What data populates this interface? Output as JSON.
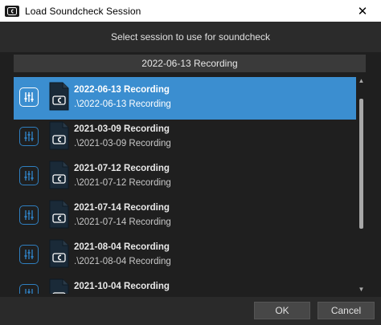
{
  "window": {
    "title": "Load Soundcheck Session",
    "close_glyph": "✕"
  },
  "header": {
    "text": "Select session to use for soundcheck"
  },
  "current": {
    "label": "2022-06-13 Recording"
  },
  "sessions": [
    {
      "name": "2022-06-13 Recording",
      "path": ".\\2022-06-13 Recording",
      "selected": true
    },
    {
      "name": "2021-03-09 Recording",
      "path": ".\\2021-03-09 Recording",
      "selected": false
    },
    {
      "name": "2021-07-12 Recording",
      "path": ".\\2021-07-12 Recording",
      "selected": false
    },
    {
      "name": "2021-07-14 Recording",
      "path": ".\\2021-07-14 Recording",
      "selected": false
    },
    {
      "name": "2021-08-04 Recording",
      "path": ".\\2021-08-04 Recording",
      "selected": false
    },
    {
      "name": "2021-10-04 Recording",
      "path": "",
      "selected": false
    }
  ],
  "buttons": {
    "ok": "OK",
    "cancel": "Cancel"
  },
  "colors": {
    "selection": "#3b8ed0",
    "accent": "#2f7fc0"
  }
}
